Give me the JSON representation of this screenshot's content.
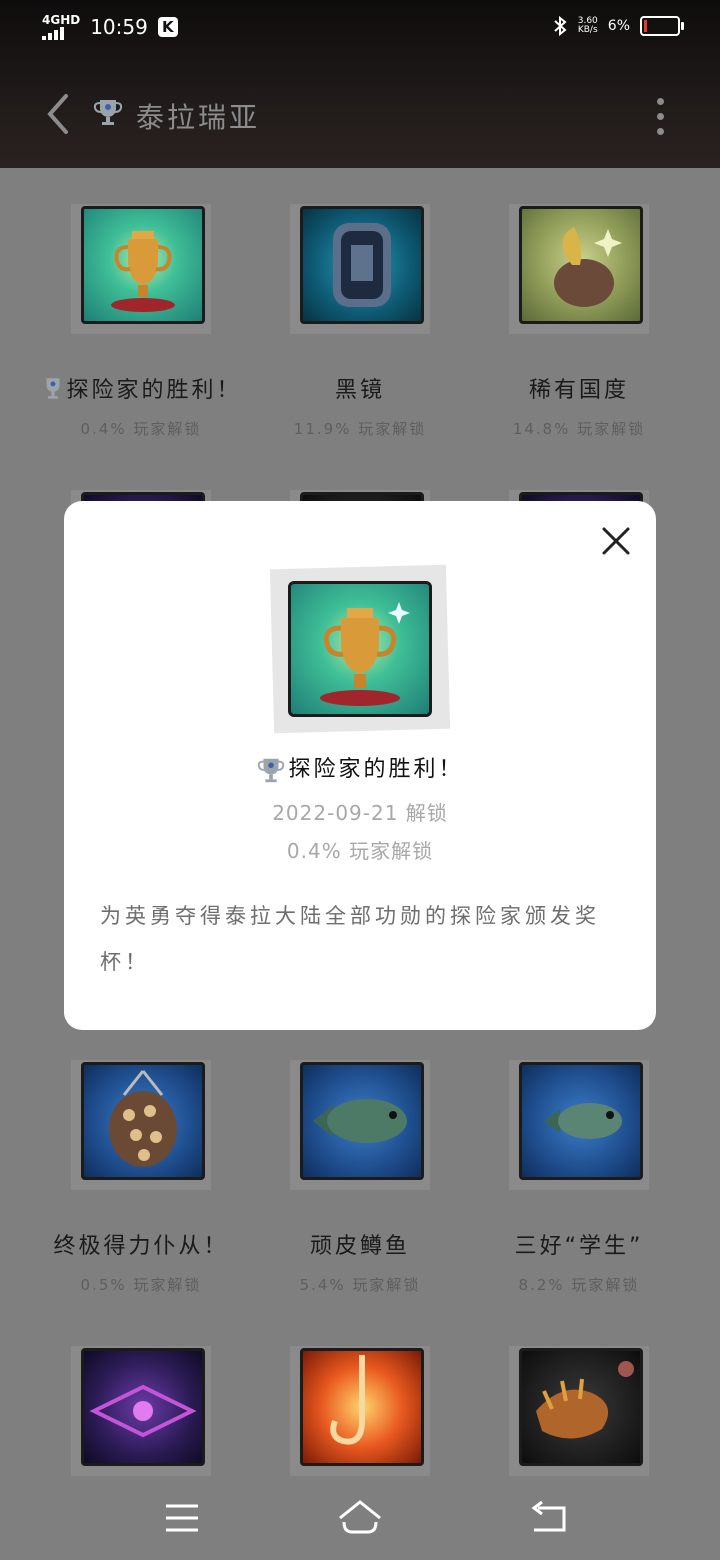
{
  "status_bar": {
    "network": "4GHD",
    "time": "10:59",
    "app_badge": "K",
    "speed_top": "3.60",
    "speed_bottom": "KB/s",
    "battery_percent": "6%"
  },
  "app_bar": {
    "title": "泰拉瑞亚"
  },
  "achievements": [
    {
      "name": "探险家的胜利！",
      "sub": "0.4% 玩家解锁",
      "theme": "teal",
      "has_trophy_prefix": true
    },
    {
      "name": "黑镜",
      "sub": "11.9% 玩家解锁",
      "theme": "tech",
      "has_trophy_prefix": false
    },
    {
      "name": "稀有国度",
      "sub": "14.8% 玩家解锁",
      "theme": "olive",
      "has_trophy_prefix": false
    },
    {
      "name": "终极得力仆从！",
      "sub": "0.5% 玩家解锁",
      "theme": "blue",
      "has_trophy_prefix": false
    },
    {
      "name": "顽皮鳟鱼",
      "sub": "5.4% 玩家解锁",
      "theme": "blue",
      "has_trophy_prefix": false
    },
    {
      "name": "三好“学生”",
      "sub": "8.2% 玩家解锁",
      "theme": "blue",
      "has_trophy_prefix": false
    },
    {
      "name": "",
      "sub": "",
      "theme": "purple",
      "has_trophy_prefix": false
    },
    {
      "name": "",
      "sub": "",
      "theme": "fire",
      "has_trophy_prefix": false
    },
    {
      "name": "",
      "sub": "",
      "theme": "dark",
      "has_trophy_prefix": false
    }
  ],
  "modal": {
    "title": "探险家的胜利！",
    "date": "2022-09-21 解锁",
    "percent": "0.4% 玩家解锁",
    "description": "为英勇夺得泰拉大陆全部功勋的探险家颁发奖杯！"
  },
  "nav": {
    "menu_icon": "menu-icon",
    "home_icon": "home-icon",
    "back_icon": "back-icon"
  }
}
